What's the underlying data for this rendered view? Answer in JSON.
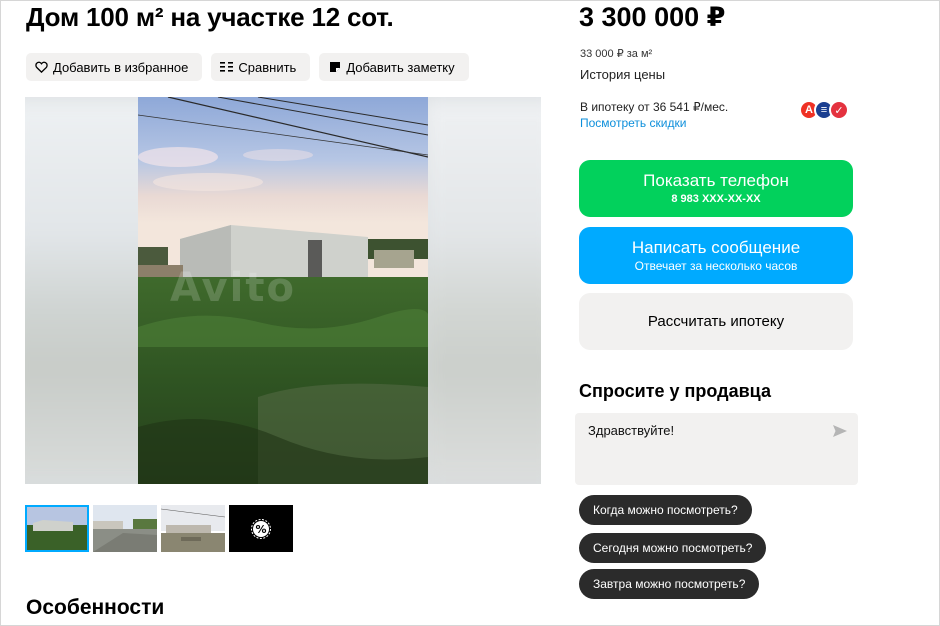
{
  "listing": {
    "title": "Дом 100 м² на участке 12 сот."
  },
  "actions": [
    {
      "label": "Добавить в избранное",
      "icon": "heart-icon"
    },
    {
      "label": "Сравнить",
      "icon": "compare-icon"
    },
    {
      "label": "Добавить заметку",
      "icon": "note-icon"
    }
  ],
  "gallery": {
    "watermark": "Avito",
    "thumbnails": [
      "photo-1",
      "photo-2",
      "photo-3",
      "video"
    ]
  },
  "sections": {
    "features_title": "Особенности"
  },
  "pricing": {
    "price": "3 300 000 ₽",
    "per_m2": "33 000 ₽ за м²",
    "history_link": "История цены",
    "mortgage_text": "В ипотеку от 36 541 ₽/мес.",
    "discounts_link": "Посмотреть скидки",
    "banks": [
      {
        "letter": "А",
        "color": "#ef3124"
      },
      {
        "letter": "≡",
        "color": "#1b3f91"
      },
      {
        "letter": "✓",
        "color": "#e4323f"
      }
    ]
  },
  "contact": {
    "phone_label": "Показать телефон",
    "phone_number": "8 983 XXX-XX-XX",
    "message_label": "Написать сообщение",
    "message_sub": "Отвечает за несколько часов",
    "mortgage_calc_label": "Рассчитать ипотеку"
  },
  "ask_seller": {
    "title": "Спросите у продавца",
    "input_value": "Здравствуйте!",
    "quick_questions": [
      "Когда можно посмотреть?",
      "Сегодня можно посмотреть?",
      "Завтра можно посмотреть?"
    ]
  },
  "colors": {
    "green": "#02d15c",
    "blue": "#00aaff",
    "link": "#0d8fdb"
  }
}
